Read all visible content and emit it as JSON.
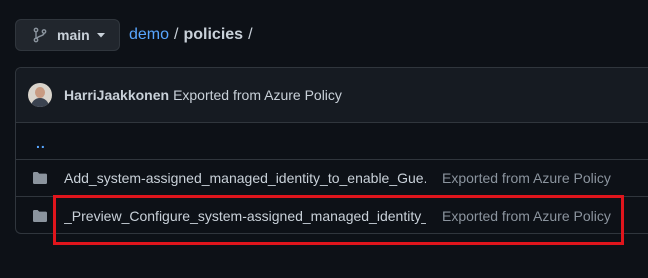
{
  "branch": {
    "name": "main",
    "icon": "git-branch-icon",
    "caret_icon": "caret-down-icon"
  },
  "breadcrumb": {
    "repo": "demo",
    "separator": "/",
    "folder": "policies",
    "trailing_separator": "/"
  },
  "latest_commit": {
    "author": "HarriJaakkonen",
    "message": "Exported from Azure Policy"
  },
  "parent_link": "..",
  "files": [
    {
      "name": "Add_system-assigned_managed_identity_to_enable_Gue...",
      "commit": "Exported from Azure Policy",
      "icon": "folder-icon"
    },
    {
      "name": "_Preview_Configure_system-assigned_managed_identity_...",
      "commit": "Exported from Azure Policy",
      "icon": "folder-icon"
    }
  ],
  "colors": {
    "background": "#0d1117",
    "border": "#30363d",
    "link": "#58a6ff",
    "muted_text": "#8b949e",
    "highlight": "#e0151c"
  }
}
